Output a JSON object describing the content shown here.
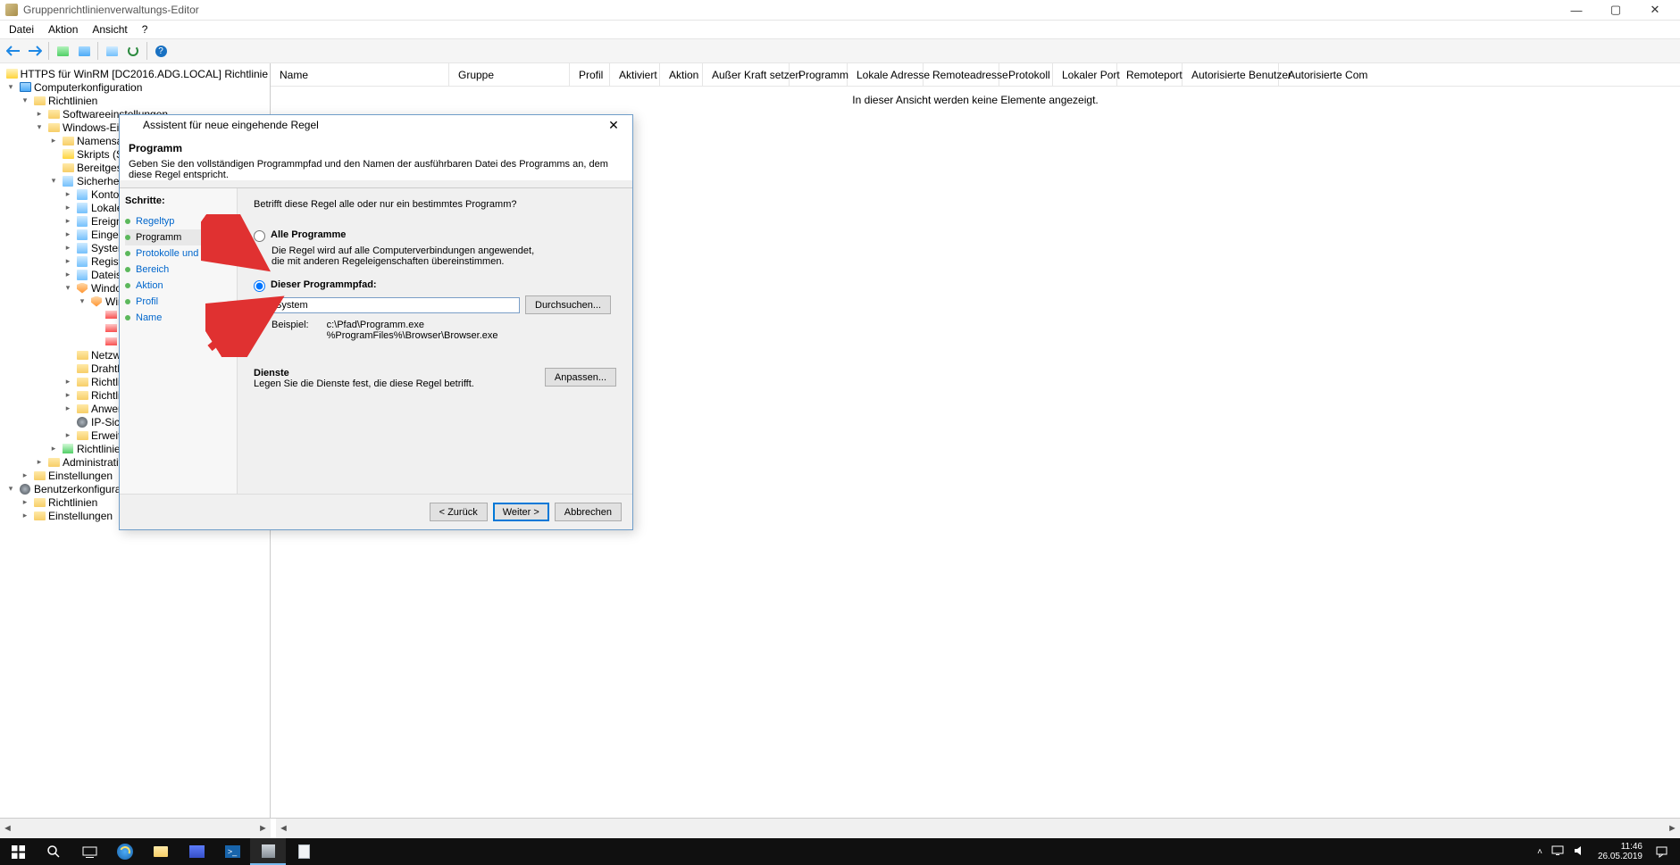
{
  "window": {
    "title": "Gruppenrichtlinienverwaltungs-Editor"
  },
  "menu": {
    "file": "Datei",
    "action": "Aktion",
    "view": "Ansicht",
    "help": "?"
  },
  "tree": {
    "root": "HTTPS für WinRM [DC2016.ADG.LOCAL] Richtlinie",
    "computer": "Computerkonfiguration",
    "policies": "Richtlinien",
    "software": "Softwareeinstellungen",
    "windows": "Windows-Einst",
    "windows_children": [
      "Namensau",
      "Skripts (Sta",
      "Bereitgeste"
    ],
    "security": "Sicherheits",
    "security_children": [
      "Kontori",
      "Lokale",
      "Ereignis",
      "Eingesc",
      "System",
      "Registri",
      "Dateisy"
    ],
    "wfirewall": "Window",
    "wfadv": "Wir",
    "netz": "Netzwe",
    "draht": "Drahtlo",
    "richtl2": "Richtlin",
    "richtl3": "Richtlin",
    "anwen": "Anwen",
    "ipsich": "IP-Sich",
    "erweite": "Erweite",
    "richtl4": "Richtlinien",
    "admin": "Administrative",
    "einst": "Einstellungen",
    "user": "Benutzerkonfiguration",
    "user_pol": "Richtlinien",
    "user_einst": "Einstellungen"
  },
  "list": {
    "columns": [
      "Name",
      "Gruppe",
      "Profil",
      "Aktiviert",
      "Aktion",
      "Außer Kraft setzen",
      "Programm",
      "Lokale Adresse",
      "Remoteadresse",
      "Protokoll",
      "Lokaler Port",
      "Remoteport",
      "Autorisierte Benutzer",
      "Autorisierte Com"
    ],
    "empty": "In dieser Ansicht werden keine Elemente angezeigt."
  },
  "dialog": {
    "title": "Assistent für neue eingehende Regel",
    "heading": "Programm",
    "subtext": "Geben Sie den vollständigen Programmpfad und den Namen der ausführbaren Datei des Programms an, dem diese Regel entspricht.",
    "steps_label": "Schritte:",
    "steps": [
      "Regeltyp",
      "Programm",
      "Protokolle und Ports",
      "Bereich",
      "Aktion",
      "Profil",
      "Name"
    ],
    "question": "Betrifft diese Regel alle oder nur ein bestimmtes Programm?",
    "opt_all": "Alle Programme",
    "opt_all_desc": "Die Regel wird auf alle Computerverbindungen angewendet, die mit anderen Regeleigenschaften übereinstimmen.",
    "opt_path": "Dieser Programmpfad:",
    "path_value": "System",
    "browse": "Durchsuchen...",
    "example_label": "Beispiel:",
    "example1": "c:\\Pfad\\Programm.exe",
    "example2": "%ProgramFiles%\\Browser\\Browser.exe",
    "services_h": "Dienste",
    "services_desc": "Legen Sie die Dienste fest, die diese Regel betrifft.",
    "customize": "Anpassen...",
    "back": "< Zurück",
    "next": "Weiter >",
    "cancel": "Abbrechen"
  },
  "taskbar": {
    "time": "11:46",
    "date": "26.05.2019"
  }
}
